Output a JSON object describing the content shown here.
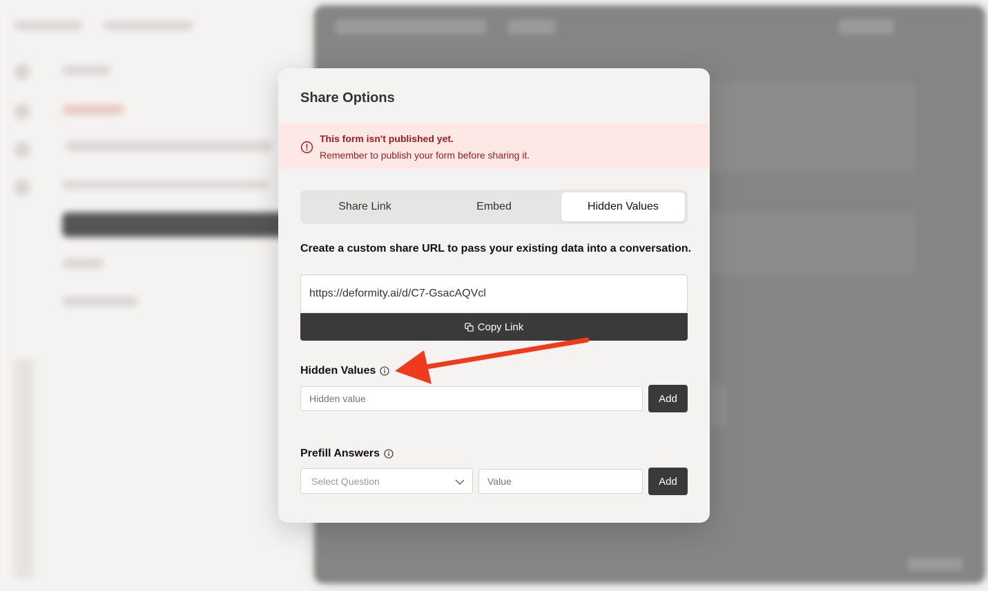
{
  "modal": {
    "title": "Share Options",
    "alert": {
      "title": "This form isn't published yet.",
      "message": "Remember to publish your form before sharing it.",
      "icon": "info-circle-icon",
      "color": "#9b1c1c",
      "background": "#fde8e6"
    },
    "tabs": [
      {
        "label": "Share Link",
        "active": false
      },
      {
        "label": "Embed",
        "active": false
      },
      {
        "label": "Hidden Values",
        "active": true
      }
    ],
    "description": "Create a custom share URL to pass your existing data into a conversation.",
    "share_url": "https://deformity.ai/d/C7-GsacAQVcl",
    "copy_button_label": "Copy Link",
    "hidden_values": {
      "label": "Hidden Values",
      "placeholder": "Hidden value",
      "add_label": "Add"
    },
    "prefill_answers": {
      "label": "Prefill Answers",
      "select_placeholder": "Select Question",
      "value_placeholder": "Value",
      "add_label": "Add"
    }
  },
  "annotation": {
    "arrow_color": "#f03a1c",
    "points_to": "Hidden Values"
  },
  "colors": {
    "button_dark": "#3a3a3a",
    "modal_bg": "#f5f3f1"
  }
}
